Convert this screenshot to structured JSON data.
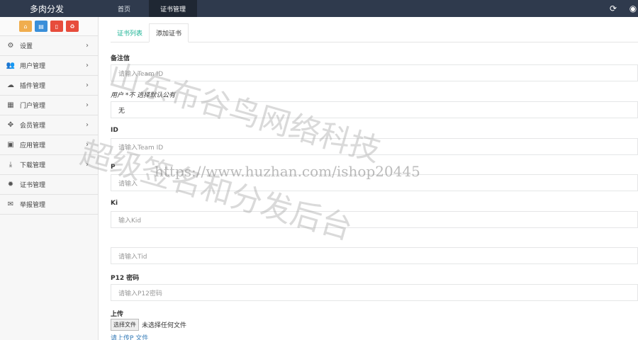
{
  "header": {
    "brand": "多肉分发",
    "nav": [
      {
        "label": "首页"
      },
      {
        "label": "证书管理"
      }
    ]
  },
  "sidebar": {
    "quick_buttons": [
      {
        "icon": "home-icon",
        "color": "#f0ad4e"
      },
      {
        "icon": "file-icon",
        "color": "#3a8fd9"
      },
      {
        "icon": "delete-icon",
        "color": "#e74c3c"
      },
      {
        "icon": "recycle-icon",
        "color": "#e74c3c"
      }
    ],
    "items": [
      {
        "label": "设置",
        "icon": "gear-icon",
        "arrow": true
      },
      {
        "label": "用户管理",
        "icon": "users-icon",
        "arrow": true
      },
      {
        "label": "插件管理",
        "icon": "cloud-icon",
        "arrow": true
      },
      {
        "label": "门户管理",
        "icon": "grid-icon",
        "arrow": true
      },
      {
        "label": "会员管理",
        "icon": "move-icon",
        "arrow": true
      },
      {
        "label": "应用管理",
        "icon": "android-icon",
        "arrow": true
      },
      {
        "label": "下载管理",
        "icon": "download-icon",
        "arrow": true
      },
      {
        "label": "证书管理",
        "icon": "cert-icon",
        "arrow": false
      },
      {
        "label": "举报管理",
        "icon": "envelope-icon",
        "arrow": false
      }
    ]
  },
  "main": {
    "tabs": [
      {
        "label": "证书列表"
      },
      {
        "label": "添加证书"
      }
    ],
    "fields": [
      {
        "label": "备注信",
        "placeholder": "请输入Team ID"
      },
      {
        "label": "用户 *不    选择默认公有",
        "value": "无"
      },
      {
        "label": "ID",
        "placeholder": "请输入Team ID"
      },
      {
        "label": "P",
        "placeholder": "请输入"
      },
      {
        "label": "Ki",
        "placeholder": "输入Kid"
      },
      {
        "label": "",
        "placeholder": "请输入Tid"
      },
      {
        "label": "P12 密码",
        "placeholder": "请输入P12密码"
      }
    ],
    "upload": {
      "label": "上传",
      "button": "选择文件",
      "status": "未选择任何文件",
      "help": "请上传P  文件"
    }
  },
  "watermark": {
    "line1": "山东布谷鸟网络科技",
    "line2": "超级签名和分发后台",
    "url": "https://www.huzhan.com/ishop20445"
  }
}
